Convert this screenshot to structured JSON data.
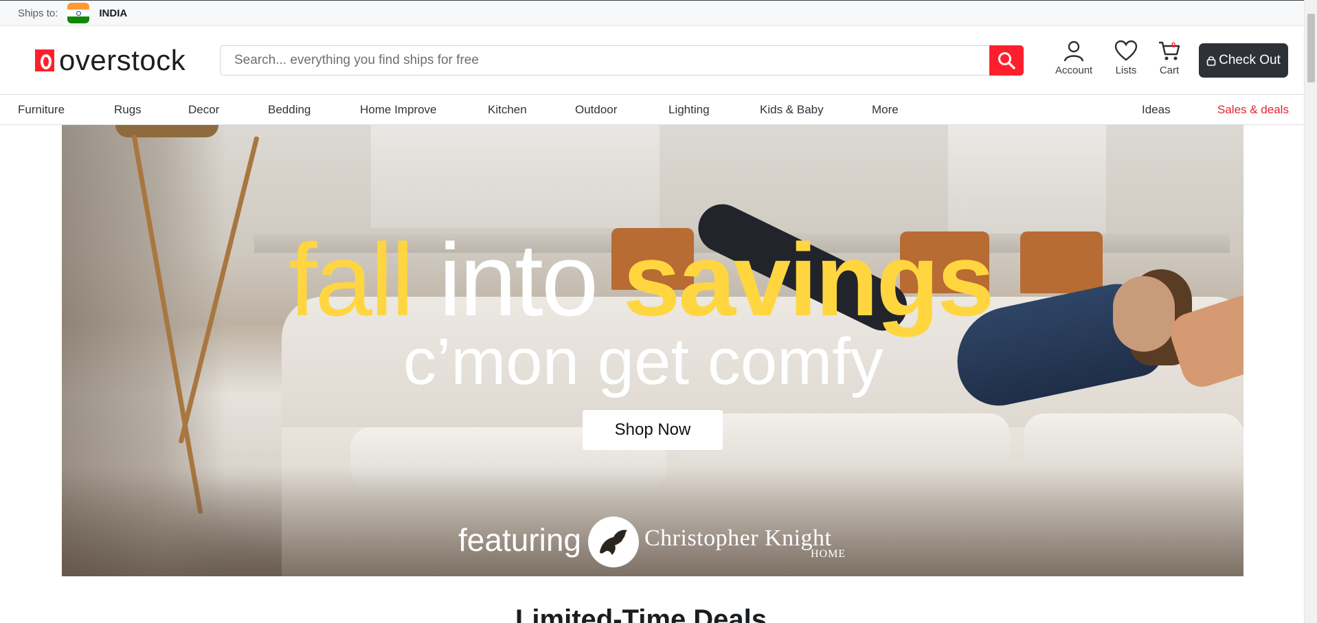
{
  "shipbar": {
    "label": "Ships to:",
    "country": "INDIA",
    "flag_icon": "india-flag-icon"
  },
  "header": {
    "logo_text": "overstock",
    "search_placeholder": "Search... everything you find ships for free",
    "account_label": "Account",
    "lists_label": "Lists",
    "cart_label": "Cart",
    "cart_count": "0",
    "checkout_label": "Check Out",
    "brand_color": "#ff1f2c"
  },
  "nav": {
    "items": [
      "Furniture",
      "Rugs",
      "Decor",
      "Bedding",
      "Home Improve",
      "Kitchen",
      "Outdoor",
      "Lighting",
      "Kids & Baby",
      "More"
    ],
    "ideas": "Ideas",
    "deals": "Sales & deals"
  },
  "hero": {
    "word1": "fall",
    "word2": "into",
    "word3": "savings",
    "subtitle": "c’mon get comfy",
    "cta": "Shop Now",
    "featuring": "featuring",
    "brand_big": "Christopher Knight",
    "brand_home": "HOME",
    "accent_color": "#ffd640"
  },
  "section": {
    "title": "Limited-Time Deals"
  }
}
